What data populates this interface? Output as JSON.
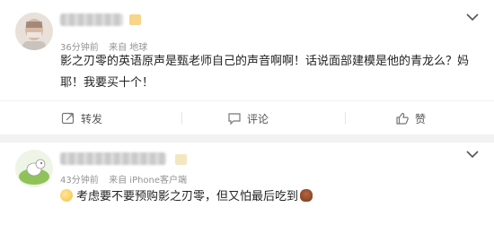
{
  "comments": [
    {
      "time": "36分钟前",
      "source": "来自 地球",
      "text": "影之刃零的英语原声是甄老师自己的声音啊啊！话说面部建模是他的青龙么？妈耶！我要买十个！",
      "actions": {
        "forward": "转发",
        "comment": "评论",
        "like": "赞"
      }
    },
    {
      "time": "43分钟前",
      "source": "来自 iPhone客户端",
      "text": "考虑要不要预购影之刃零，但又怕最后吃到"
    }
  ],
  "icons": [
    "more-dots-icon",
    "forward-icon",
    "comment-icon",
    "like-icon",
    "smile-emoji-icon",
    "poop-emoji-icon"
  ],
  "colors": {
    "background": "#ffffff",
    "divider": "#f2f2f2",
    "meta": "#939393",
    "badge": "#f7d58a"
  }
}
